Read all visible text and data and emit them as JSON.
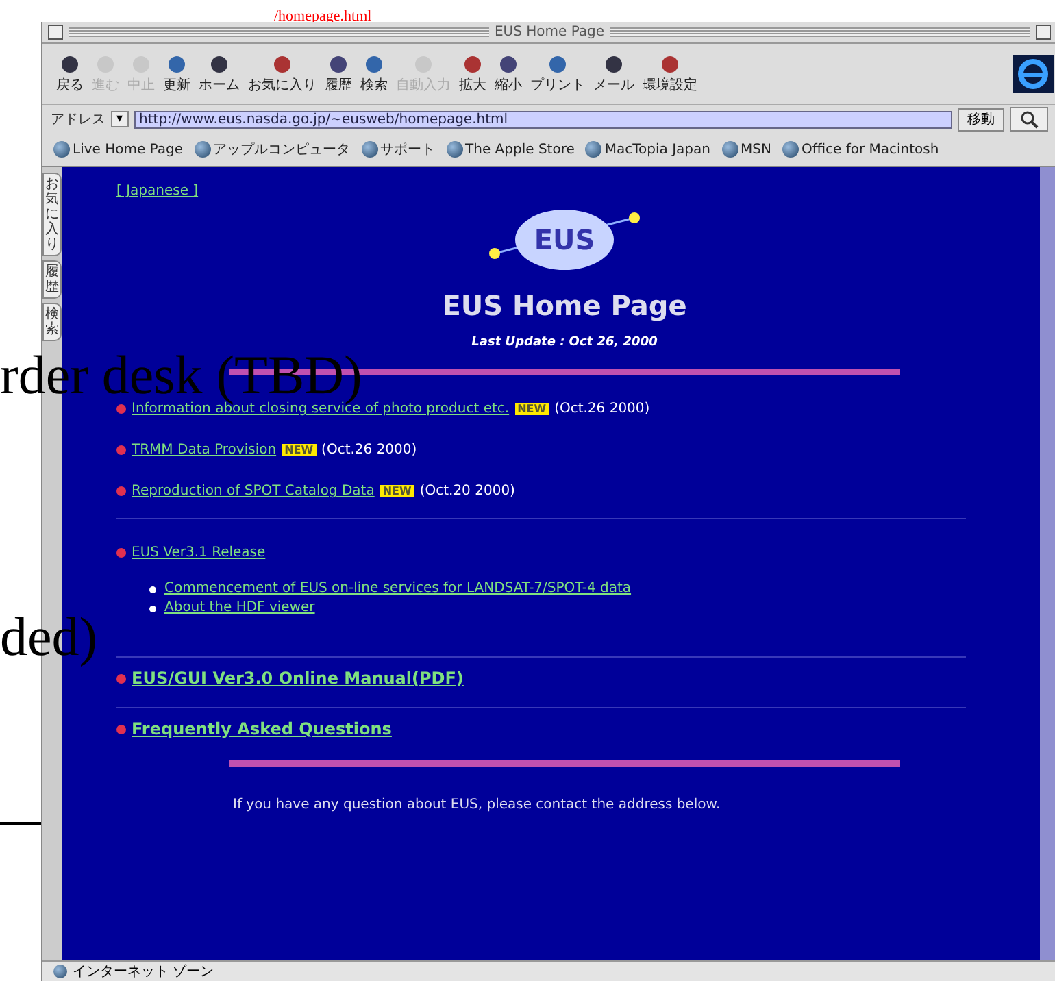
{
  "background_page": {
    "link": "/homepage.html",
    "texts": [
      "rder desk (TBD)",
      "ded)"
    ]
  },
  "window": {
    "title": "EUS Home Page"
  },
  "toolbar": [
    {
      "label": "戻る",
      "disabled": false
    },
    {
      "label": "進む",
      "disabled": true
    },
    {
      "label": "中止",
      "disabled": true
    },
    {
      "label": "更新",
      "disabled": false
    },
    {
      "label": "ホーム",
      "disabled": false
    },
    {
      "label": "お気に入り",
      "disabled": false
    },
    {
      "label": "履歴",
      "disabled": false
    },
    {
      "label": "検索",
      "disabled": false
    },
    {
      "label": "自動入力",
      "disabled": true
    },
    {
      "label": "拡大",
      "disabled": false
    },
    {
      "label": "縮小",
      "disabled": false
    },
    {
      "label": "プリント",
      "disabled": false
    },
    {
      "label": "メール",
      "disabled": false
    },
    {
      "label": "環境設定",
      "disabled": false
    }
  ],
  "address": {
    "label": "アドレス",
    "value": "http://www.eus.nasda.go.jp/~eusweb/homepage.html",
    "go": "移動",
    "dropdown": "▾"
  },
  "favorites": [
    "Live Home Page",
    "アップルコンピュータ",
    "サポート",
    "The Apple Store",
    "MacTopia Japan",
    "MSN",
    "Office for Macintosh"
  ],
  "side_tabs": [
    "お気に入り",
    "履歴",
    "検索"
  ],
  "page": {
    "language_link": "[ Japanese ]",
    "logo_text": "EUS",
    "heading": "EUS Home Page",
    "last_update": "Last Update : Oct 26, 2000",
    "news": [
      {
        "link": "Information about closing service of photo product etc.",
        "badge": "NEW",
        "date": "(Oct.26 2000)"
      },
      {
        "link": "TRMM Data Provision",
        "badge": "NEW",
        "date": "(Oct.26 2000)"
      },
      {
        "link": "Reproduction of SPOT Catalog Data",
        "badge": "NEW",
        "date": "(Oct.20 2000)"
      }
    ],
    "release": {
      "link": "EUS Ver3.1 Release",
      "items": [
        "Commencement of EUS on-line services for LANDSAT-7/SPOT-4 data",
        "About the HDF viewer"
      ]
    },
    "manual": "EUS/GUI Ver3.0 Online Manual(PDF)",
    "faq": "Frequently Asked Questions",
    "footer": "If you have any question about EUS, please contact the address below."
  },
  "status_bar": "インターネット ゾーン"
}
